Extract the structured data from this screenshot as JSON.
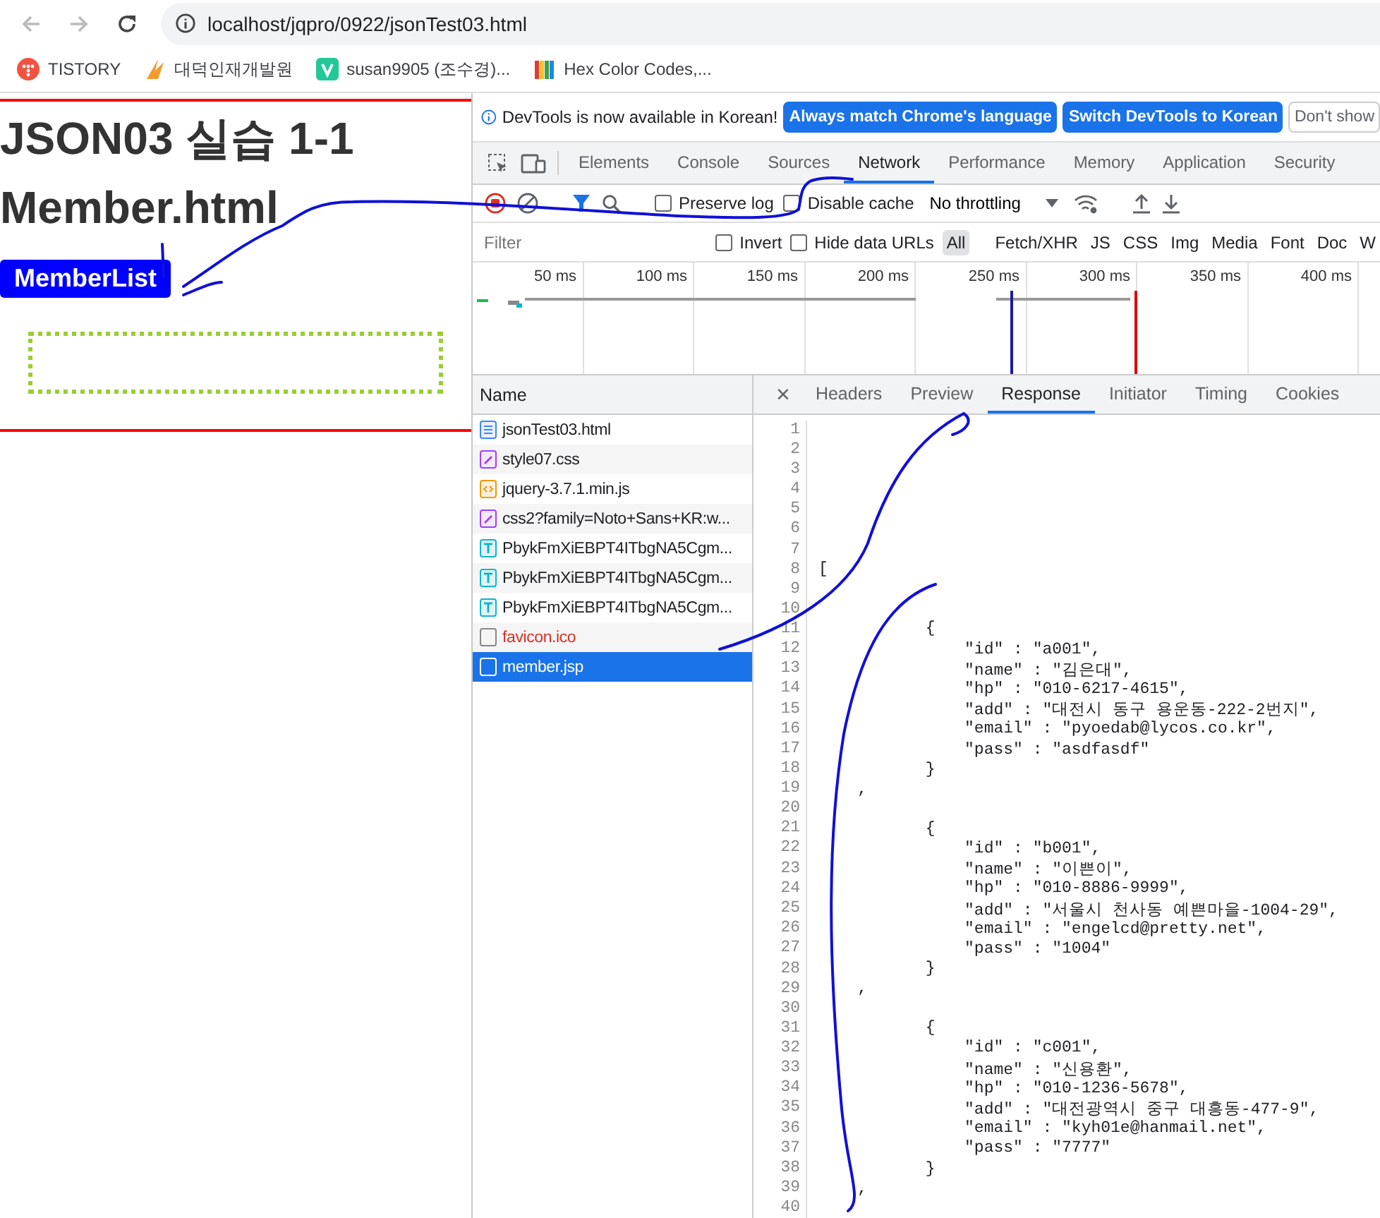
{
  "browser": {
    "url": "localhost/jqpro/0922/jsonTest03.html",
    "bookmarks": [
      {
        "label": "TISTORY",
        "kind": "tistory"
      },
      {
        "label": "대덕인재개발원",
        "kind": "flame"
      },
      {
        "label": "susan9905 (조수경)...",
        "kind": "velog"
      },
      {
        "label": "Hex Color Codes,...",
        "kind": "books"
      }
    ]
  },
  "page": {
    "title_lines": [
      "JSON03 실습 1-1",
      "Member.html"
    ],
    "button": "MemberList"
  },
  "devtools": {
    "infobar": {
      "message": "DevTools is now available in Korean!",
      "buttons": [
        {
          "label": "Always match Chrome's language",
          "primary": true
        },
        {
          "label": "Switch DevTools to Korean",
          "primary": true
        },
        {
          "label": "Don't show",
          "primary": false
        }
      ]
    },
    "tabs": [
      {
        "label": "Elements",
        "selected": false
      },
      {
        "label": "Console",
        "selected": false
      },
      {
        "label": "Sources",
        "selected": false
      },
      {
        "label": "Network",
        "selected": true
      },
      {
        "label": "Performance",
        "selected": false
      },
      {
        "label": "Memory",
        "selected": false
      },
      {
        "label": "Application",
        "selected": false
      },
      {
        "label": "Security",
        "selected": false
      }
    ],
    "toolbar": {
      "checkboxes": [
        {
          "label": "Preserve log",
          "checked": false
        },
        {
          "label": "Disable cache",
          "checked": false
        }
      ],
      "throttling": "No throttling"
    },
    "filter": {
      "placeholder": "Filter",
      "checkboxes": [
        {
          "label": "Invert",
          "checked": false
        },
        {
          "label": "Hide data URLs",
          "checked": false
        }
      ],
      "types": [
        {
          "label": "All",
          "selected": true
        },
        {
          "label": "Fetch/XHR",
          "selected": false
        },
        {
          "label": "JS",
          "selected": false
        },
        {
          "label": "CSS",
          "selected": false
        },
        {
          "label": "Img",
          "selected": false
        },
        {
          "label": "Media",
          "selected": false
        },
        {
          "label": "Font",
          "selected": false
        },
        {
          "label": "Doc",
          "selected": false
        },
        {
          "label": "W",
          "selected": false
        }
      ]
    },
    "timeline": {
      "ticks": [
        "50 ms",
        "100 ms",
        "150 ms",
        "200 ms",
        "250 ms",
        "300 ms",
        "350 ms",
        "400 ms"
      ]
    },
    "requests": {
      "header": "Name",
      "rows": [
        {
          "name": "jsonTest03.html",
          "kind": "document",
          "failed": false,
          "selected": false
        },
        {
          "name": "style07.css",
          "kind": "stylesheet",
          "failed": false,
          "selected": false
        },
        {
          "name": "jquery-3.7.1.min.js",
          "kind": "script",
          "failed": false,
          "selected": false
        },
        {
          "name": "css2?family=Noto+Sans+KR:w...",
          "kind": "stylesheet",
          "failed": false,
          "selected": false
        },
        {
          "name": "PbykFmXiEBPT4ITbgNA5Cgm...",
          "kind": "font",
          "failed": false,
          "selected": false
        },
        {
          "name": "PbykFmXiEBPT4ITbgNA5Cgm...",
          "kind": "font",
          "failed": false,
          "selected": false
        },
        {
          "name": "PbykFmXiEBPT4ITbgNA5Cgm...",
          "kind": "font",
          "failed": false,
          "selected": false
        },
        {
          "name": "favicon.ico",
          "kind": "other",
          "failed": true,
          "selected": false
        },
        {
          "name": "member.jsp",
          "kind": "other",
          "failed": false,
          "selected": true
        }
      ]
    },
    "detail": {
      "close": "×",
      "tabs": [
        {
          "label": "Headers",
          "selected": false
        },
        {
          "label": "Preview",
          "selected": false
        },
        {
          "label": "Response",
          "selected": true
        },
        {
          "label": "Initiator",
          "selected": false
        },
        {
          "label": "Timing",
          "selected": false
        },
        {
          "label": "Cookies",
          "selected": false
        }
      ],
      "lines": [
        {
          "number": "1"
        },
        {
          "number": "2"
        },
        {
          "number": "3"
        },
        {
          "number": "4"
        },
        {
          "number": "5"
        },
        {
          "number": "6"
        },
        {
          "number": "7"
        },
        {
          "number": "8",
          "text": "["
        },
        {
          "number": "9"
        },
        {
          "number": "10"
        },
        {
          "number": "11",
          "text": "           {"
        },
        {
          "number": "12",
          "text": "               \"id\" : \"a001\","
        },
        {
          "number": "13",
          "text": "               \"name\" : \"김은대\","
        },
        {
          "number": "14",
          "text": "               \"hp\" : \"010-6217-4615\","
        },
        {
          "number": "15",
          "text": "               \"add\" : \"대전시 동구 용운동-222-2번지\","
        },
        {
          "number": "16",
          "text": "               \"email\" : \"pyoedab@lycos.co.kr\","
        },
        {
          "number": "17",
          "text": "               \"pass\" : \"asdfasdf\""
        },
        {
          "number": "18",
          "text": "           }"
        },
        {
          "number": "19",
          "text": "    ,"
        },
        {
          "number": "20"
        },
        {
          "number": "21",
          "text": "           {"
        },
        {
          "number": "22",
          "text": "               \"id\" : \"b001\","
        },
        {
          "number": "23",
          "text": "               \"name\" : \"이쁜이\","
        },
        {
          "number": "24",
          "text": "               \"hp\" : \"010-8886-9999\","
        },
        {
          "number": "25",
          "text": "               \"add\" : \"서울시 천사동 예쁜마을-1004-29\","
        },
        {
          "number": "26",
          "text": "               \"email\" : \"engelcd@pretty.net\","
        },
        {
          "number": "27",
          "text": "               \"pass\" : \"1004\""
        },
        {
          "number": "28",
          "text": "           }"
        },
        {
          "number": "29",
          "text": "    ,"
        },
        {
          "number": "30"
        },
        {
          "number": "31",
          "text": "           {"
        },
        {
          "number": "32",
          "text": "               \"id\" : \"c001\","
        },
        {
          "number": "33",
          "text": "               \"name\" : \"신용환\","
        },
        {
          "number": "34",
          "text": "               \"hp\" : \"010-1236-5678\","
        },
        {
          "number": "35",
          "text": "               \"add\" : \"대전광역시 중구 대흥동-477-9\","
        },
        {
          "number": "36",
          "text": "               \"email\" : \"kyh01e@hanmail.net\","
        },
        {
          "number": "37",
          "text": "               \"pass\" : \"7777\""
        },
        {
          "number": "38",
          "text": "           }"
        },
        {
          "number": "39",
          "text": "    ,"
        },
        {
          "number": "40"
        }
      ]
    }
  }
}
